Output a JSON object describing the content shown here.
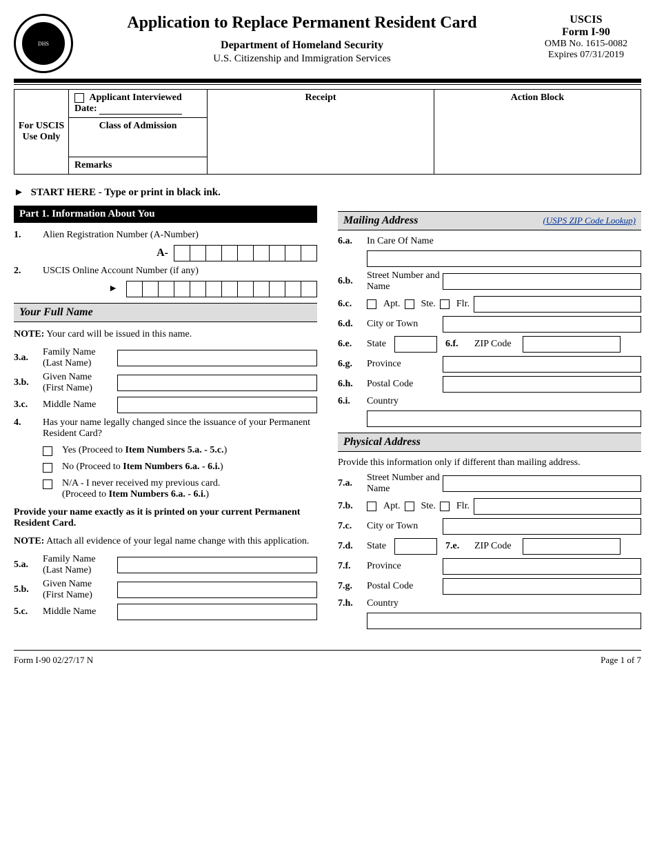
{
  "header": {
    "title": "Application to Replace Permanent Resident Card",
    "department": "Department of Homeland Security",
    "agency": "U.S. Citizenship and Immigration Services",
    "uscis": "USCIS",
    "form_no": "Form I-90",
    "omb": "OMB No. 1615-0082",
    "expires": "Expires 07/31/2019"
  },
  "uscis_box": {
    "side_label": "For USCIS Use Only",
    "interviewed": "Applicant Interviewed",
    "date_label": "Date:",
    "class_label": "Class of Admission",
    "remarks_label": "Remarks",
    "receipt_label": "Receipt",
    "action_label": "Action Block"
  },
  "start_here": "START HERE - Type or print in black ink.",
  "part1": {
    "heading": "Part 1.  Information About You",
    "q1_num": "1.",
    "q1_label": "Alien Registration Number (A-Number)",
    "a_prefix": "A-",
    "q2_num": "2.",
    "q2_label": "USCIS Online Account Number (if any)",
    "full_name_heading": "Your Full Name",
    "note1_prefix": "NOTE:",
    "note1": "  Your card will be issued in this name.",
    "q3a_num": "3.a.",
    "q3a_label": "Family Name (Last Name)",
    "q3b_num": "3.b.",
    "q3b_label": "Given Name (First Name)",
    "q3c_num": "3.c.",
    "q3c_label": "Middle Name",
    "q4_num": "4.",
    "q4_label": "Has your name legally changed since the issuance of your Permanent Resident Card?",
    "q4_yes": "Yes (Proceed to ",
    "q4_yes_bold": "Item Numbers 5.a. - 5.c.",
    "q4_no": "No (Proceed to ",
    "q4_no_bold": "Item Numbers 6.a. - 6.i.",
    "q4_na1": "N/A - I never received my previous card.",
    "q4_na2": "(Proceed to ",
    "q4_na2_bold": "Item Numbers 6.a. - 6.i.",
    "provide_name": "Provide your name exactly as it is printed on your current Permanent Resident Card.",
    "note2_prefix": "NOTE:",
    "note2": "  Attach all evidence of your legal name change with this application.",
    "q5a_num": "5.a.",
    "q5a_label": "Family Name (Last Name)",
    "q5b_num": "5.b.",
    "q5b_label": "Given Name (First Name)",
    "q5c_num": "5.c.",
    "q5c_label": "Middle Name"
  },
  "mailing": {
    "heading": "Mailing Address",
    "link": "(USPS ZIP Code Lookup)",
    "q6a_num": "6.a.",
    "q6a_label": "In Care Of Name",
    "q6b_num": "6.b.",
    "q6b_label": "Street Number and Name",
    "q6c_num": "6.c.",
    "apt": "Apt.",
    "ste": "Ste.",
    "flr": "Flr.",
    "q6d_num": "6.d.",
    "q6d_label": "City or Town",
    "q6e_num": "6.e.",
    "q6e_label": "State",
    "q6f_num": "6.f.",
    "q6f_label": "ZIP Code",
    "q6g_num": "6.g.",
    "q6g_label": "Province",
    "q6h_num": "6.h.",
    "q6h_label": "Postal Code",
    "q6i_num": "6.i.",
    "q6i_label": "Country"
  },
  "physical": {
    "heading": "Physical Address",
    "note": "Provide this information only if different than mailing address.",
    "q7a_num": "7.a.",
    "q7a_label": "Street Number and Name",
    "q7b_num": "7.b.",
    "q7c_num": "7.c.",
    "q7c_label": "City or Town",
    "q7d_num": "7.d.",
    "q7d_label": "State",
    "q7e_num": "7.e.",
    "q7e_label": "ZIP Code",
    "q7f_num": "7.f.",
    "q7f_label": "Province",
    "q7g_num": "7.g.",
    "q7g_label": "Postal Code",
    "q7h_num": "7.h.",
    "q7h_label": "Country"
  },
  "footer": {
    "left": "Form I-90   02/27/17   N",
    "right": "Page 1 of 7"
  }
}
